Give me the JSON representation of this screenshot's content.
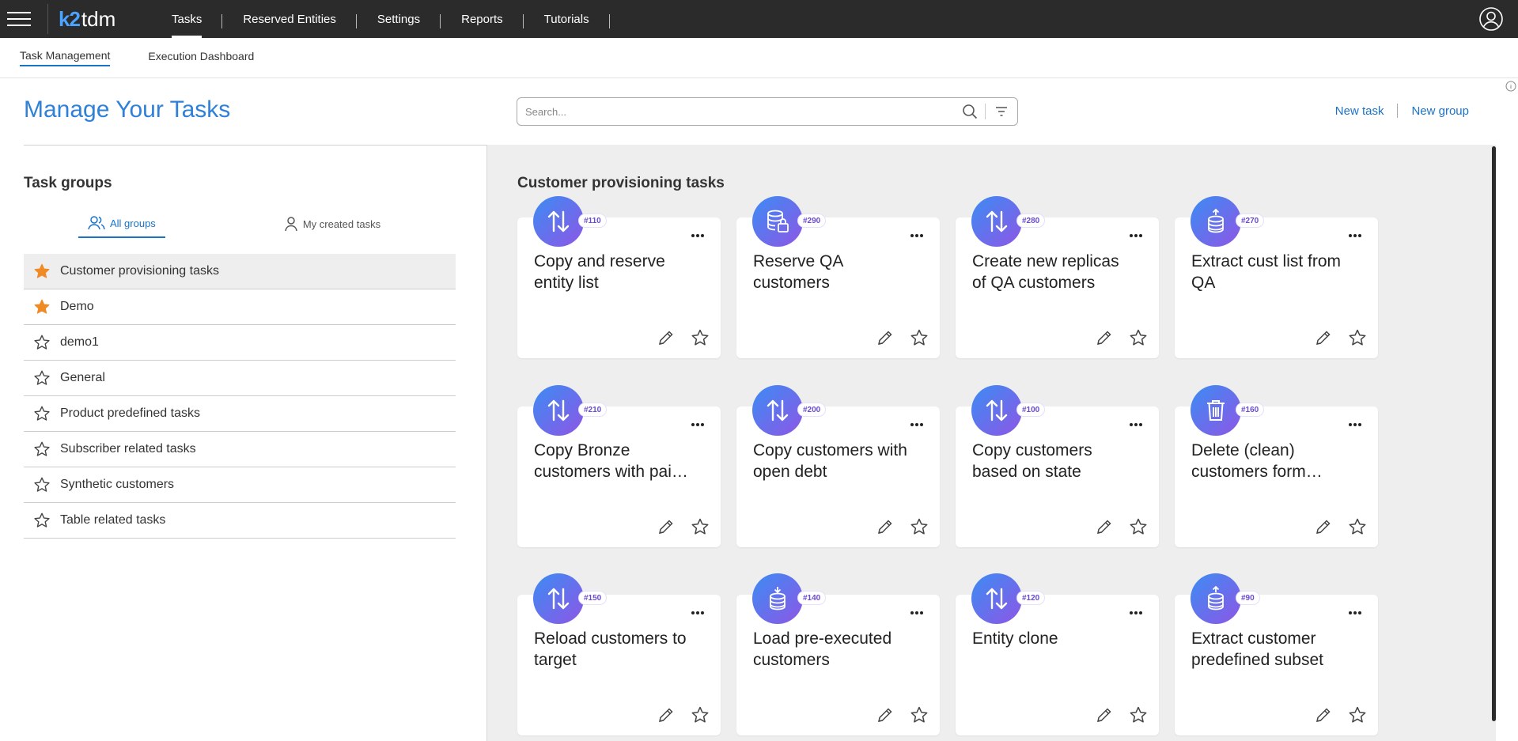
{
  "app": {
    "logo_k2": "k2",
    "logo_tdm": "tdm"
  },
  "nav": {
    "items": [
      {
        "label": "Tasks",
        "active": true
      },
      {
        "label": "Reserved Entities",
        "active": false
      },
      {
        "label": "Settings",
        "active": false
      },
      {
        "label": "Reports",
        "active": false
      },
      {
        "label": "Tutorials",
        "active": false
      }
    ]
  },
  "subnav": {
    "tabs": [
      {
        "label": "Task Management",
        "active": true
      },
      {
        "label": "Execution Dashboard",
        "active": false
      }
    ]
  },
  "header": {
    "title": "Manage Your Tasks",
    "search_placeholder": "Search...",
    "search_value": "",
    "new_task": "New task",
    "new_group": "New group"
  },
  "left": {
    "title": "Task groups",
    "tab_all": "All groups",
    "tab_mine": "My created tasks",
    "groups": [
      {
        "label": "Customer provisioning tasks",
        "starred": true,
        "selected": true
      },
      {
        "label": "Demo",
        "starred": true,
        "selected": false
      },
      {
        "label": "demo1",
        "starred": false,
        "selected": false
      },
      {
        "label": "General",
        "starred": false,
        "selected": false
      },
      {
        "label": "Product predefined tasks",
        "starred": false,
        "selected": false
      },
      {
        "label": "Subscriber related tasks",
        "starred": false,
        "selected": false
      },
      {
        "label": "Synthetic customers",
        "starred": false,
        "selected": false
      },
      {
        "label": "Table related tasks",
        "starred": false,
        "selected": false
      }
    ]
  },
  "main": {
    "title": "Customer provisioning tasks",
    "tasks": [
      {
        "id": "#110",
        "name": "Copy and reserve entity list",
        "icon": "arrows-swap-icon"
      },
      {
        "id": "#290",
        "name": "Reserve QA customers",
        "icon": "database-lock-icon"
      },
      {
        "id": "#280",
        "name": "Create new replicas of QA customers",
        "icon": "arrows-swap-icon"
      },
      {
        "id": "#270",
        "name": "Extract cust list from QA",
        "icon": "database-upload-icon"
      },
      {
        "id": "#210",
        "name": "Copy Bronze customers with paid plans",
        "icon": "arrows-swap-icon"
      },
      {
        "id": "#200",
        "name": "Copy customers with open debt",
        "icon": "arrows-swap-icon"
      },
      {
        "id": "#100",
        "name": "Copy customers based on state",
        "icon": "arrows-swap-icon"
      },
      {
        "id": "#160",
        "name": "Delete (clean) customers form target",
        "icon": "trash-icon"
      },
      {
        "id": "#150",
        "name": "Reload customers to target",
        "icon": "arrows-swap-icon"
      },
      {
        "id": "#140",
        "name": "Load pre-executed customers",
        "icon": "database-download-icon"
      },
      {
        "id": "#120",
        "name": "Entity clone",
        "icon": "arrows-swap-icon"
      },
      {
        "id": "#90",
        "name": "Extract customer predefined subset",
        "icon": "database-upload-icon"
      }
    ]
  },
  "colors": {
    "accent": "#1a73c9",
    "star": "#f08a24",
    "topbar": "#2b2b2b",
    "icon_gradient_start": "#3b8cf3",
    "icon_gradient_end": "#8e56e6"
  }
}
